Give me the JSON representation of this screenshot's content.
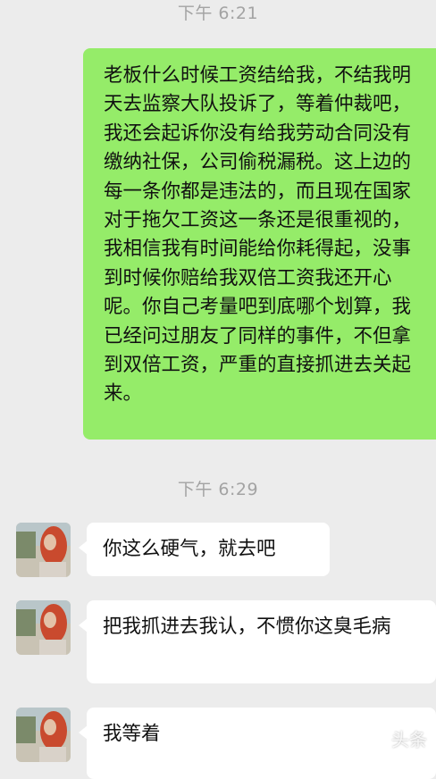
{
  "chat": {
    "timestamps": [
      "下午 6:21",
      "下午 6:29"
    ],
    "outgoing": {
      "text": "老板什么时候工资结给我，不结我明天去监察大队投诉了，等着仲裁吧，我还会起诉你没有给我劳动合同没有缴纳社保，公司偷税漏税。这上边的每一条你都是违法的，而且现在国家对于拖欠工资这一条还是很重视的，我相信我有时间能给你耗得起，没事到时候你赔给我双倍工资我还开心呢。你自己考量吧到底哪个划算，我已经问过朋友了同样的事件，不但拿到双倍工资，严重的直接抓进去关起来。"
    },
    "incoming": [
      {
        "text": "你这么硬气，就去吧"
      },
      {
        "text": "把我抓进去我认，不惯你这臭毛病"
      },
      {
        "text": "我等着"
      }
    ]
  },
  "colors": {
    "background": "#ececec",
    "outgoing_bubble": "#95ec69",
    "incoming_bubble": "#ffffff",
    "timestamp_text": "#a3a3a3"
  },
  "watermark": {
    "text": "头条"
  }
}
